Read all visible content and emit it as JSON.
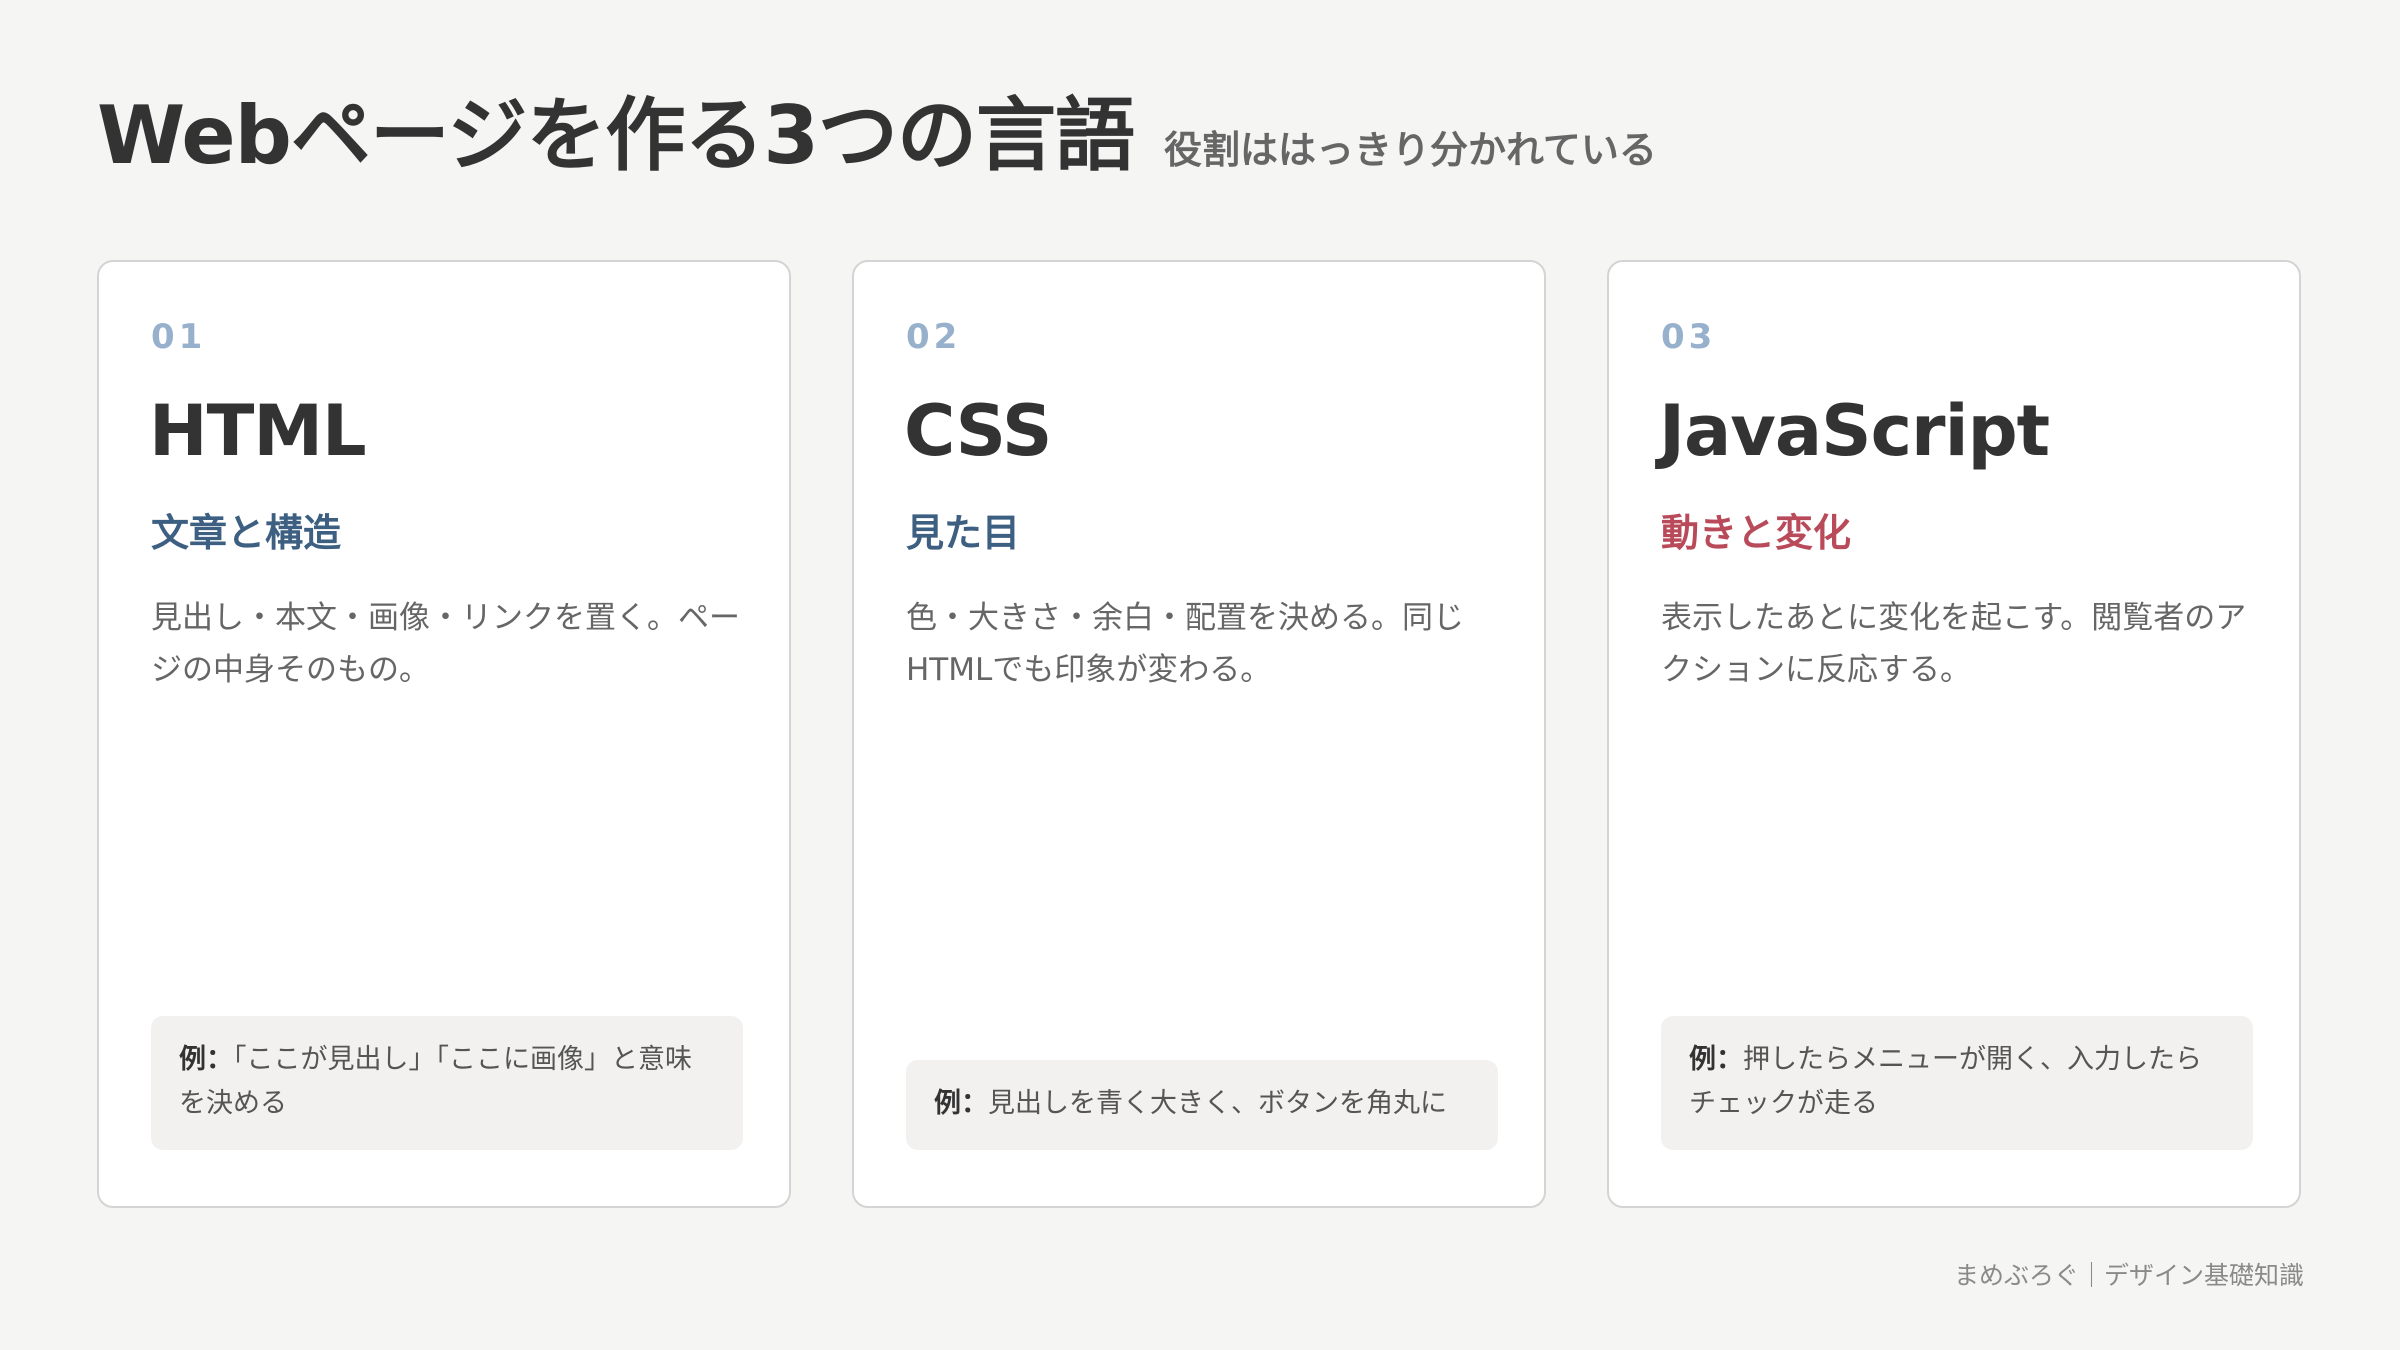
{
  "header": {
    "title": "Webページを作る3つの言語",
    "subtitle": "役割ははっきり分かれている"
  },
  "cards": [
    {
      "number": "01",
      "name": "HTML",
      "role": "文章と構造",
      "description": "見出し・本文・画像・リンクを置く。ページの中身そのもの。",
      "example_label": "例：",
      "example_text": "「ここが見出し」「ここに画像」と意味を決める"
    },
    {
      "number": "02",
      "name": "CSS",
      "role": "見た目",
      "description": "色・大きさ・余白・配置を決める。同じHTMLでも印象が変わる。",
      "example_label": "例：",
      "example_text": "見出しを青く大きく、ボタンを角丸に"
    },
    {
      "number": "03",
      "name": "JavaScript",
      "role": "動きと変化",
      "description": "表示したあとに変化を起こす。閲覧者のアクションに反応する。",
      "example_label": "例：",
      "example_text": "押したらメニューが開く、入力したらチェックが走る"
    }
  ],
  "colors": {
    "number": "#97b0cc",
    "role_blue": "#3d5f82",
    "role_red": "#b84a5a"
  },
  "footer": {
    "credit": "まめぶろぐ｜デザイン基礎知識"
  }
}
